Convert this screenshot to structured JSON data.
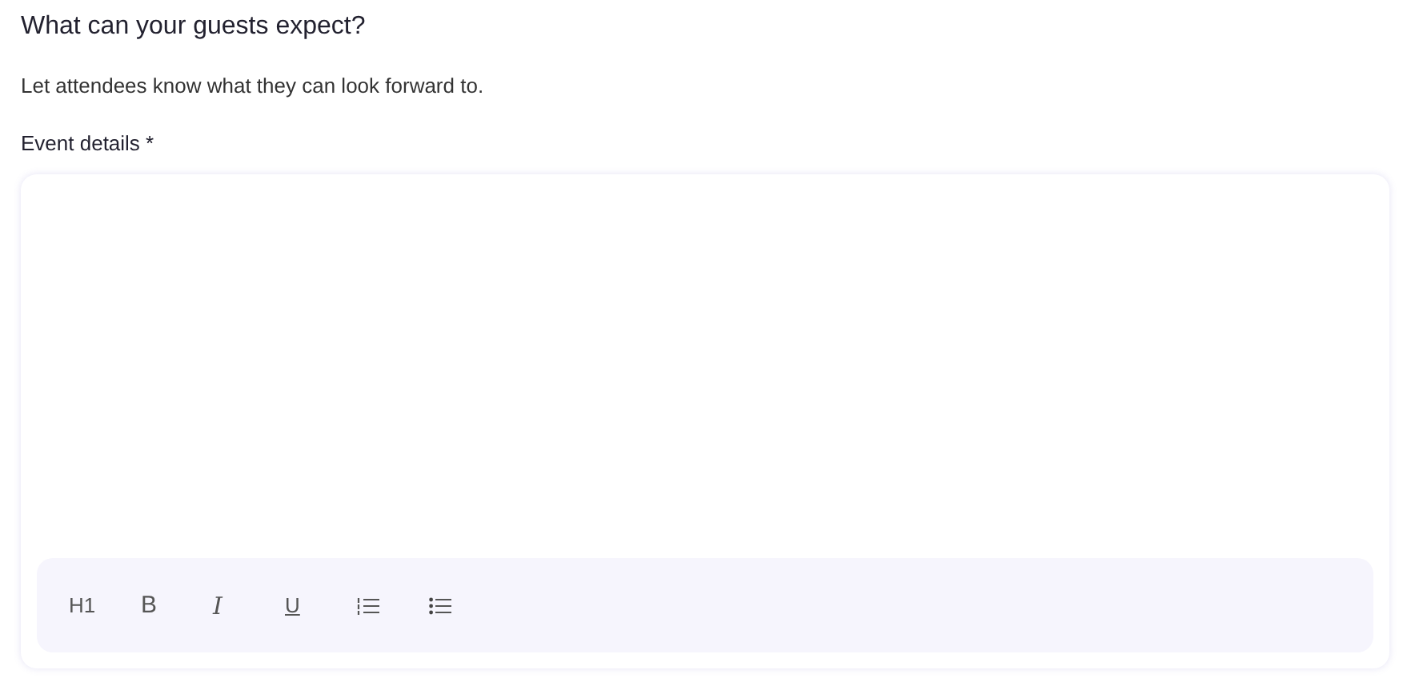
{
  "heading": "What can your guests expect?",
  "description": "Let attendees know what they can look forward to.",
  "field": {
    "label": "Event details *"
  },
  "toolbar": [
    {
      "kind": "heading",
      "label": "H1"
    },
    {
      "kind": "bold",
      "label": "B"
    },
    {
      "kind": "italic",
      "label": "I"
    },
    {
      "kind": "underline",
      "label": "U"
    },
    {
      "kind": "numbered-list"
    },
    {
      "kind": "bullet-list"
    }
  ]
}
